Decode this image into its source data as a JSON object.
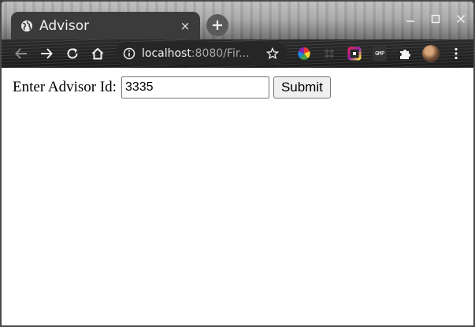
{
  "browser": {
    "tab": {
      "title": "Advisor",
      "close_glyph": "×",
      "favicon": "globe-icon"
    },
    "newtab_glyph": "+",
    "window_controls": {
      "minimize": "–",
      "maximize": "□",
      "close": "✕"
    },
    "address_bar": {
      "host": "localhost",
      "rest": ":8080/Fir..."
    },
    "extensions": [
      "color-wheel-icon",
      "grid-extension-icon",
      "gradient-square-icon",
      "gmp-icon",
      "puzzle-icon"
    ],
    "gmp_label": "GMP"
  },
  "form": {
    "label": "Enter Advisor Id:",
    "input_value": "3335",
    "submit_label": "Submit"
  },
  "colors": {
    "tab_bg": "#3b3b3b",
    "toolbar_bg": "#1f1f1f",
    "page_bg": "#ffffff"
  }
}
